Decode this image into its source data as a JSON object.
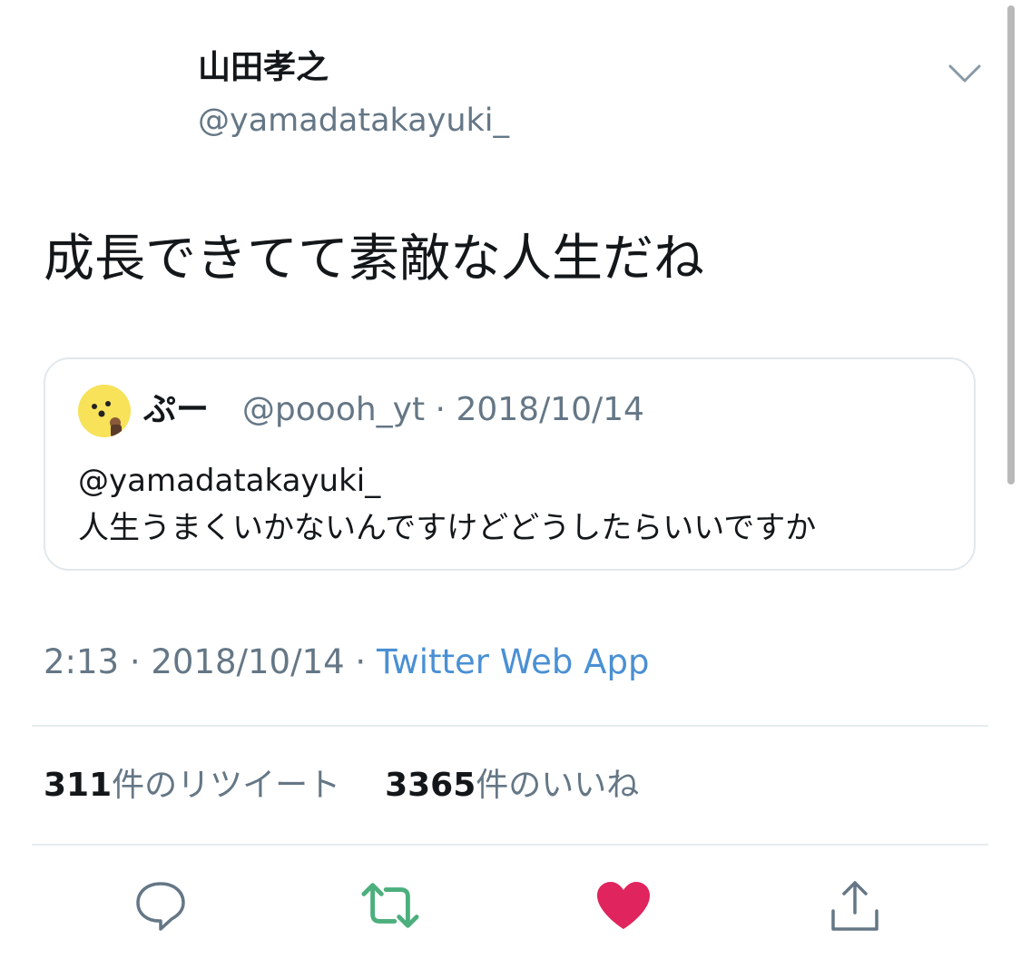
{
  "tweet": {
    "author": {
      "display_name": "山田孝之",
      "handle": "@yamadatakayuki_"
    },
    "menu_icon": "chevron-down-icon",
    "text": "成長できてて素敵な人生だね",
    "quoted": {
      "avatar_icon": "avatar-yellow-face",
      "display_name": "ぷー",
      "handle": "@poooh_yt",
      "separator": "·",
      "date": "2018/10/14",
      "body_line1": "@yamadatakayuki_",
      "body_line2": "人生うまくいかないんですけどどうしたらいいですか"
    },
    "meta": {
      "time": "2:13",
      "sep1": "·",
      "date": "2018/10/14",
      "sep2": "·",
      "source": "Twitter Web App"
    },
    "stats": {
      "retweet_count": "311",
      "retweet_label": "件のリツイート",
      "like_count": "3365",
      "like_label": "件のいいね"
    },
    "actions": {
      "reply_icon": "reply-icon",
      "retweet_icon": "retweet-icon",
      "like_icon": "heart-icon",
      "share_icon": "share-icon"
    }
  },
  "colors": {
    "text_primary": "#14171a",
    "text_secondary": "#657786",
    "link": "#4a90d4",
    "retweet_green": "#4caf7d",
    "like_red": "#e0245e",
    "divider": "#e6ecf0",
    "avatar_yellow": "#f7e25a"
  }
}
